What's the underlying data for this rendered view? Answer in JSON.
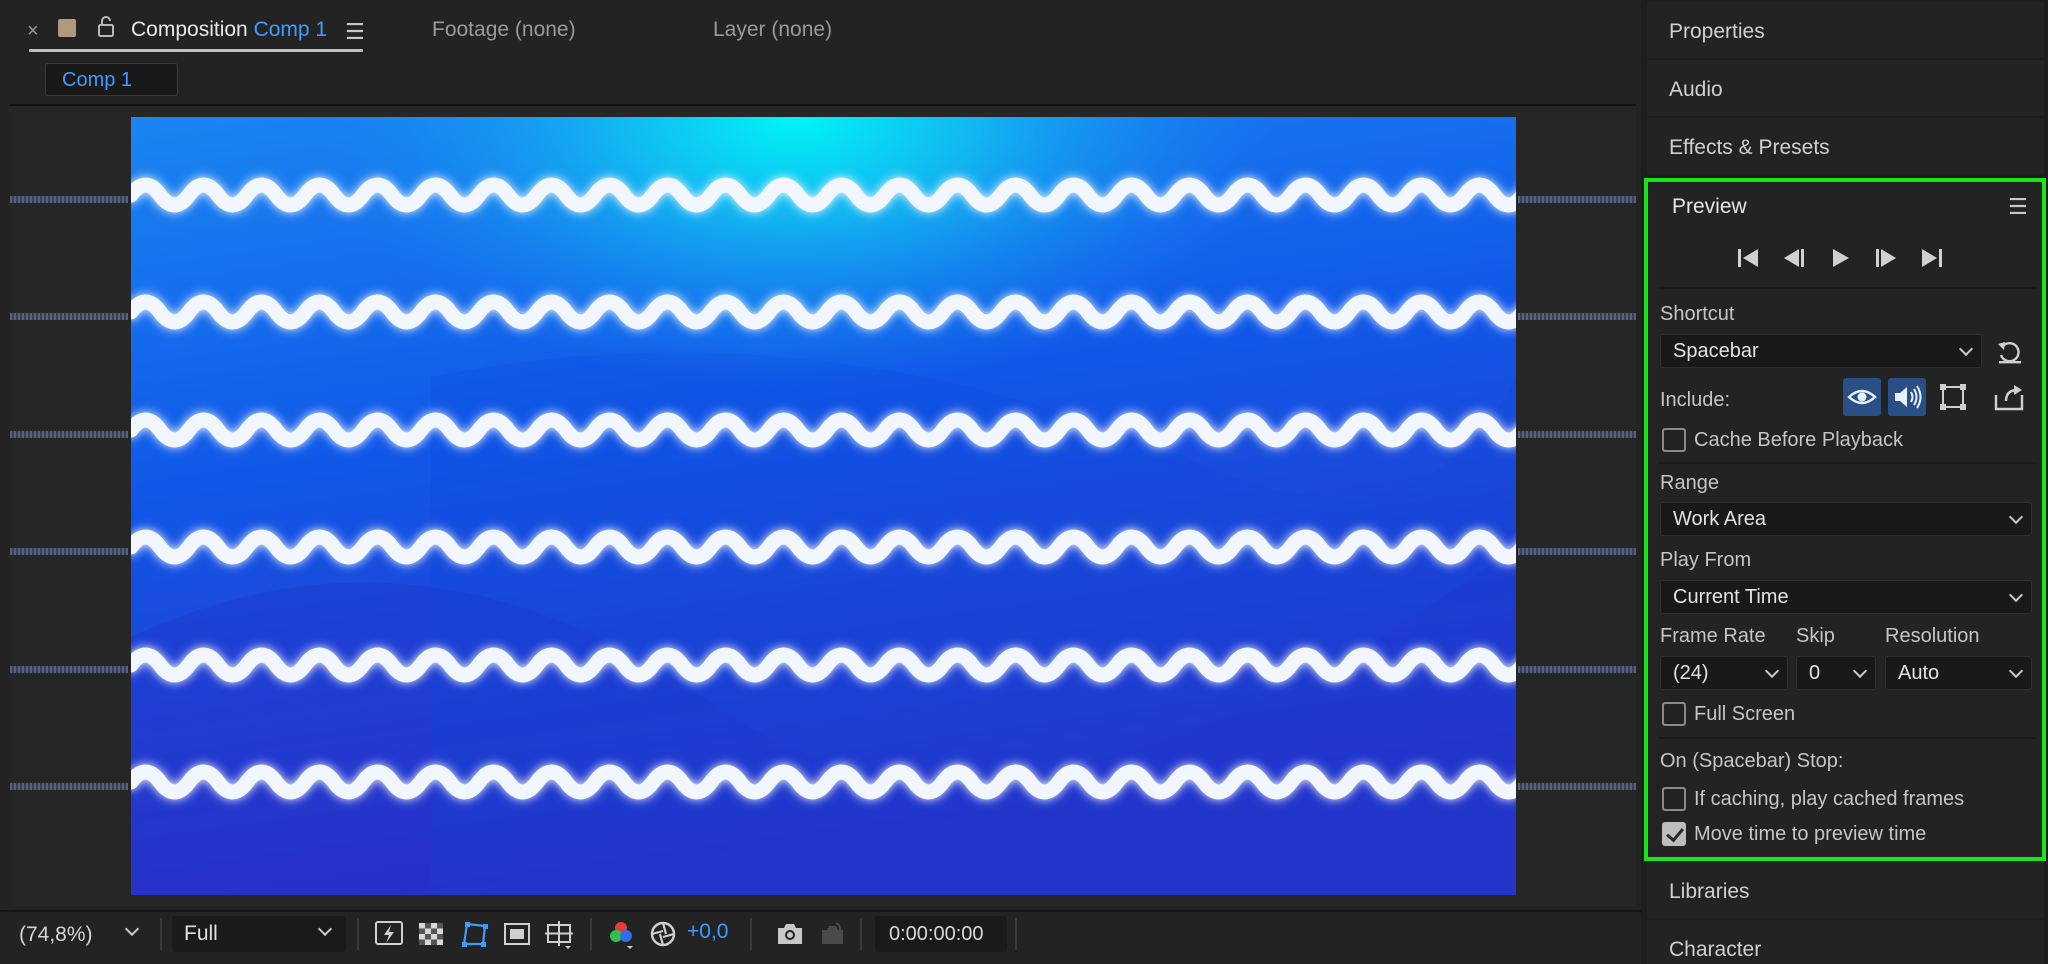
{
  "comp_panel": {
    "tab_title": "Composition",
    "tab_comp_name": "Comp 1",
    "footage_tab": "Footage (none)",
    "layer_tab": "Layer (none)",
    "breadcrumb": "Comp 1"
  },
  "viewer_toolbar": {
    "zoom": "(74,8%)",
    "resolution": "Full",
    "exposure": "+0,0",
    "timecode": "0:00:00:00"
  },
  "dock": {
    "properties": "Properties",
    "audio": "Audio",
    "effects": "Effects & Presets",
    "libraries": "Libraries",
    "character": "Character"
  },
  "preview": {
    "title": "Preview",
    "shortcut_label": "Shortcut",
    "shortcut_value": "Spacebar",
    "include_label": "Include:",
    "cache_before_playback": "Cache Before Playback",
    "range_label": "Range",
    "range_value": "Work Area",
    "play_from_label": "Play From",
    "play_from_value": "Current Time",
    "frame_rate_label": "Frame Rate",
    "frame_rate_value": "(24)",
    "skip_label": "Skip",
    "skip_value": "0",
    "resolution_label": "Resolution",
    "resolution_value": "Auto",
    "full_screen": "Full Screen",
    "on_stop_label": "On (Spacebar) Stop:",
    "if_caching": "If caching, play cached frames",
    "move_time": "Move time to preview time",
    "checks": {
      "cache_before_playback": false,
      "full_screen": false,
      "if_caching": false,
      "move_time": true
    }
  },
  "colors": {
    "accent": "#3f9cff",
    "highlight_border": "#19e619",
    "panel_bg": "#232323"
  }
}
